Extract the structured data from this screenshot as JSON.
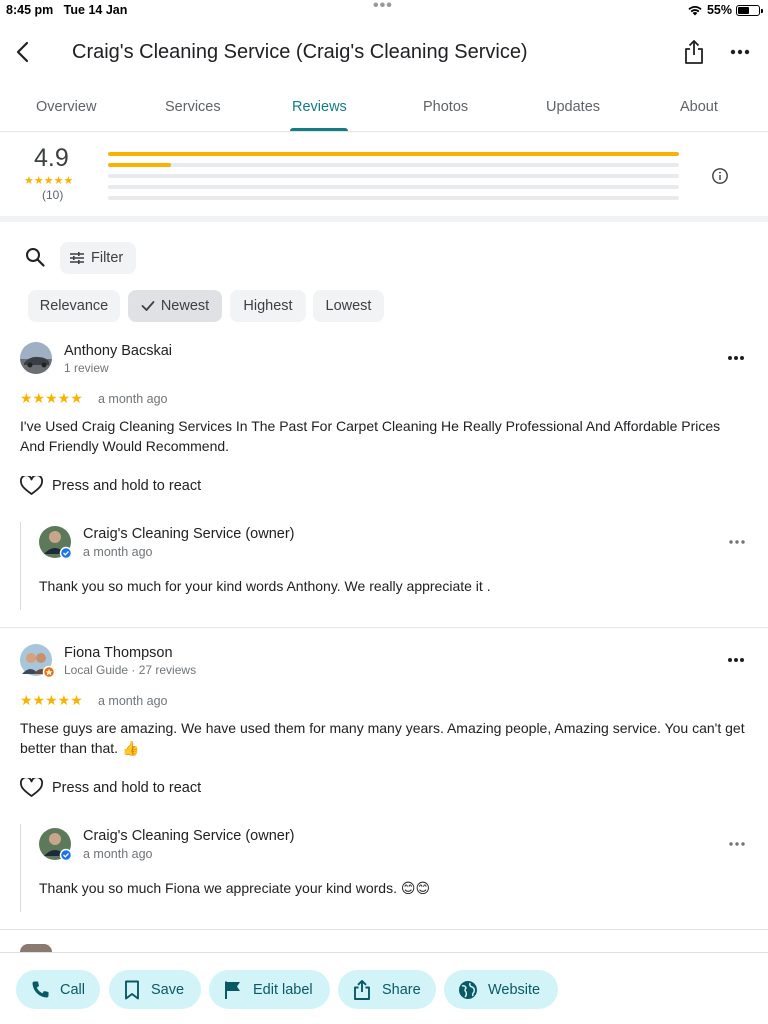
{
  "status_bar": {
    "time": "8:45 pm",
    "date": "Tue 14 Jan",
    "battery": "55%",
    "battery_level": 0.55
  },
  "header": {
    "title": "Craig's Cleaning Service (Craig's Cleaning Service)"
  },
  "tabs": [
    {
      "label": "Overview"
    },
    {
      "label": "Services"
    },
    {
      "label": "Reviews",
      "active": true
    },
    {
      "label": "Photos"
    },
    {
      "label": "Updates"
    },
    {
      "label": "About"
    }
  ],
  "rating": {
    "average": "4.9",
    "stars": "★★★★★",
    "count": "(10)",
    "distribution": [
      {
        "stars": 5,
        "fraction": 1.0
      },
      {
        "stars": 4,
        "fraction": 0.11
      },
      {
        "stars": 3,
        "fraction": 0
      },
      {
        "stars": 2,
        "fraction": 0
      },
      {
        "stars": 1,
        "fraction": 0
      }
    ]
  },
  "filter": {
    "label": "Filter"
  },
  "sort_chips": [
    {
      "label": "Relevance"
    },
    {
      "label": "Newest",
      "selected": true
    },
    {
      "label": "Highest"
    },
    {
      "label": "Lowest"
    }
  ],
  "reviews": [
    {
      "name": "Anthony Bacskai",
      "meta": "1 review",
      "stars": "★★★★★",
      "when": "a month ago",
      "text": "I've Used Craig Cleaning Services In The Past For Carpet Cleaning He Really Professional And Affordable Prices And Friendly Would Recommend.",
      "react": "Press and hold to react",
      "owner": {
        "name": "Craig's Cleaning Service (owner)",
        "when": "a month ago",
        "text": "Thank you so much for your kind words Anthony. We really appreciate it ."
      }
    },
    {
      "name": "Fiona Thompson",
      "meta": "Local Guide · 27 reviews",
      "stars": "★★★★★",
      "when": "a month ago",
      "text": "These guys are amazing. We have used them for many many years. Amazing people, Amazing service. You can't get better than that. 👍",
      "react": "Press and hold to react",
      "owner": {
        "name": "Craig's Cleaning Service (owner)",
        "when": "a month ago",
        "text": "Thank you so much Fiona we appreciate your kind words. 😊😊"
      }
    }
  ],
  "actions": [
    {
      "label": "Call",
      "icon": "phone-icon"
    },
    {
      "label": "Save",
      "icon": "bookmark-icon"
    },
    {
      "label": "Edit label",
      "icon": "flag-icon"
    },
    {
      "label": "Share",
      "icon": "share-icon"
    },
    {
      "label": "Website",
      "icon": "globe-icon"
    }
  ],
  "colors": {
    "accent": "#137c85",
    "star": "#f9b200",
    "action_bg": "#d2f3f7",
    "action_text": "#0b5a63"
  }
}
